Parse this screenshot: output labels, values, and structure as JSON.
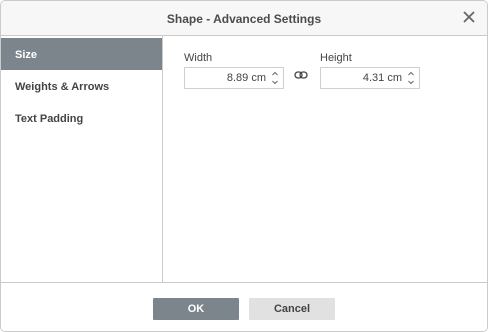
{
  "dialog": {
    "title": "Shape - Advanced Settings",
    "close_icon": "close-icon"
  },
  "sidebar": {
    "items": [
      {
        "label": "Size",
        "active": true
      },
      {
        "label": "Weights & Arrows",
        "active": false
      },
      {
        "label": "Text Padding",
        "active": false
      }
    ]
  },
  "size": {
    "width_label": "Width",
    "width_value": "8.89 cm",
    "height_label": "Height",
    "height_value": "4.31 cm",
    "aspect_icon": "link-icon"
  },
  "footer": {
    "ok_label": "OK",
    "cancel_label": "Cancel"
  },
  "colors": {
    "active_tab": "#7d858c",
    "primary_button": "#7d858c",
    "secondary_button": "#e1e1e1"
  }
}
